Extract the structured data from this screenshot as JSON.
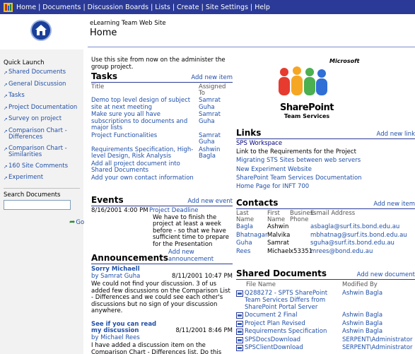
{
  "topnav": [
    "Home",
    "Documents",
    "Discussion Boards",
    "Lists",
    "Create",
    "Site Settings",
    "Help"
  ],
  "site": {
    "name": "eLearning Team Web Site",
    "page_title": "Home"
  },
  "quicklaunch": {
    "title": "Quick Launch",
    "items": [
      "Shared Documents",
      "General Discussion",
      "Tasks",
      "Project Documentation",
      "Survey on project",
      "Comparison Chart - Differences",
      "Comparison Chart - Similarities",
      "160 Site Comments",
      "Experiment"
    ]
  },
  "search": {
    "label": "Search Documents",
    "go": "Go"
  },
  "intro": "Use this site from now on the administer the group project.",
  "tasks": {
    "title": "Tasks",
    "add": "Add new item",
    "col_title": "Title",
    "col_assigned": "Assigned To",
    "items": [
      {
        "title": "Demo top level design of subject site at next meeting",
        "assigned": "Samrat Guha"
      },
      {
        "title": "Make sure you all have subscriptions to documents and major lists",
        "assigned": "Samrat Guha"
      },
      {
        "title": "Project Functionalities",
        "assigned": "Samrat Guha"
      },
      {
        "title": "Requirements Specification, High-level Design, Risk Analysis",
        "assigned": "Ashwin Bagla"
      },
      {
        "title": "Add all project document into Shared Documents",
        "assigned": ""
      },
      {
        "title": "Add your own contact information",
        "assigned": ""
      }
    ]
  },
  "events": {
    "title": "Events",
    "add": "Add new event",
    "items": [
      {
        "date": "8/16/2001 4:00 PM",
        "title": "Project Deadline",
        "body": "We have to finish the project at least a week before - so that we have sufficient time to prepare for the Presentation"
      }
    ]
  },
  "announcements": {
    "title": "Announcements",
    "add": "Add new announcement",
    "items": [
      {
        "title": "Sorry Michaell",
        "by": "by Samrat Guha",
        "date": "8/11/2001 10:47 PM",
        "body": "We could not find your discussion. 3 of us added few discussions on the Comparison List - Differences and we could see each other's discussions but no sign of your discussion anywhere."
      },
      {
        "title": "See if you can read my discussion",
        "by": "by Michael Rees",
        "date": "8/11/2001 8:46 PM",
        "body": "I have added a discussion item on the Comparison Chart - Differences list. Do this"
      }
    ]
  },
  "sharepoint_logo": {
    "brand": "Microsoft",
    "product": "SharePoint",
    "sub": "Team Services"
  },
  "links": {
    "title": "Links",
    "add": "Add new link",
    "items": [
      "SPS Workspace",
      "Link to the Requirements for the Project",
      "Migrating STS Sites between web servers",
      "New Experiment Website",
      "SharePoint Team Services Documentation",
      "Home Page for INFT 700"
    ]
  },
  "contacts": {
    "title": "Contacts",
    "add": "Add new item",
    "headers": [
      "Last Name",
      "First Name",
      "Business Phone",
      "E-mail Address"
    ],
    "rows": [
      [
        "Bagla",
        "Ashwin",
        "",
        "asbagla@surf.its.bond.edu.au"
      ],
      [
        "Bhatnagar",
        "Malvika",
        "",
        "mbhatnag@surf.its.bond.edu.au"
      ],
      [
        "Guha",
        "Samrat",
        "",
        "sguha@surf.its.bond.edu.au"
      ],
      [
        "Rees",
        "Michael",
        "x53351",
        "mrees@bond.edu.au"
      ]
    ]
  },
  "shared_documents": {
    "title": "Shared Documents",
    "add": "Add new document",
    "col_name": "File Name",
    "col_modified": "Modified By",
    "items": [
      {
        "name": "Q288272 - SPTS SharePoint Team Services Differs from SharePoint Portal Server",
        "by": "Ashwin Bagla"
      },
      {
        "name": "Document 2 Final",
        "by": "Ashwin Bagla"
      },
      {
        "name": "Project Plan Revised",
        "by": "Ashwin Bagla"
      },
      {
        "name": "Requirements Specification",
        "by": "Ashwin Bagla"
      },
      {
        "name": "SPSDocsDownload",
        "by": "SERPENT\\Administrator"
      },
      {
        "name": "SPSClientDownload",
        "by": "SERPENT\\Administrator"
      }
    ]
  },
  "colors": {
    "topbar": "#2b3a96",
    "link": "#2050a8",
    "leftnav": "#f2f2f2"
  }
}
